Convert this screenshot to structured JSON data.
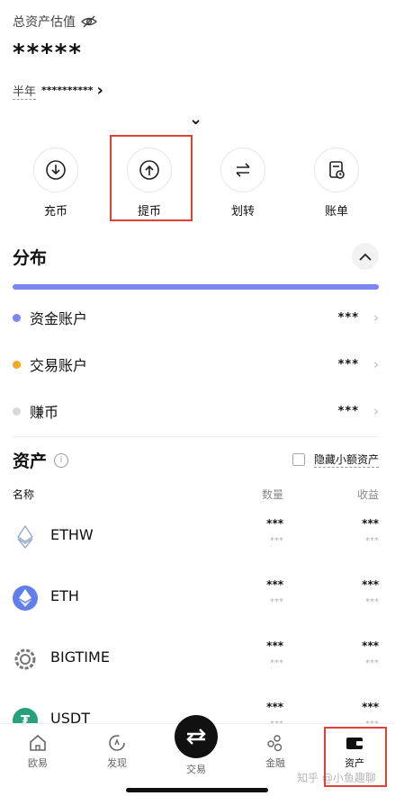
{
  "header": {
    "title": "总资产估值",
    "balance_masked": "*****",
    "period_label": "半年",
    "period_value_masked": "**********",
    "period_chevron": "›",
    "expand_chevron": "⌄"
  },
  "actions": [
    {
      "label": "充币",
      "icon": "deposit-icon"
    },
    {
      "label": "提币",
      "icon": "withdraw-icon"
    },
    {
      "label": "划转",
      "icon": "transfer-icon"
    },
    {
      "label": "账单",
      "icon": "bill-icon"
    }
  ],
  "distribution": {
    "title": "分布",
    "collapse_chevron": "⌃",
    "rows": [
      {
        "name": "资金账户",
        "value": "***",
        "color": "#7b86f0"
      },
      {
        "name": "交易账户",
        "value": "***",
        "color": "#f5a623"
      },
      {
        "name": "赚币",
        "value": "***",
        "color": "#d9d9d9"
      }
    ]
  },
  "assets": {
    "title": "资产",
    "hide_small_label": "隐藏小额资产",
    "columns": {
      "name": "名称",
      "qty": "数量",
      "income": "收益"
    },
    "rows": [
      {
        "name": "ETHW",
        "qty": "***",
        "qty_sub": "***",
        "income": "***",
        "income_sub": "***",
        "icon": "ethw-icon"
      },
      {
        "name": "ETH",
        "qty": "***",
        "qty_sub": "***",
        "income": "***",
        "income_sub": "***",
        "icon": "eth-icon"
      },
      {
        "name": "BIGTIME",
        "qty": "***",
        "qty_sub": "***",
        "income": "***",
        "income_sub": "***",
        "icon": "bigtime-icon"
      },
      {
        "name": "USDT",
        "qty": "***",
        "qty_sub": "***",
        "income": "***",
        "income_sub": "***",
        "icon": "usdt-icon"
      }
    ]
  },
  "nav": [
    {
      "label": "欧易",
      "icon": "home-icon"
    },
    {
      "label": "发现",
      "icon": "discover-icon"
    },
    {
      "label": "交易",
      "icon": "trade-icon"
    },
    {
      "label": "金融",
      "icon": "finance-icon"
    },
    {
      "label": "资产",
      "icon": "wallet-icon"
    }
  ],
  "watermark": "知乎 @小鱼趣聊",
  "colors": {
    "accent": "#7b86f0",
    "highlight": "#e0413a"
  }
}
